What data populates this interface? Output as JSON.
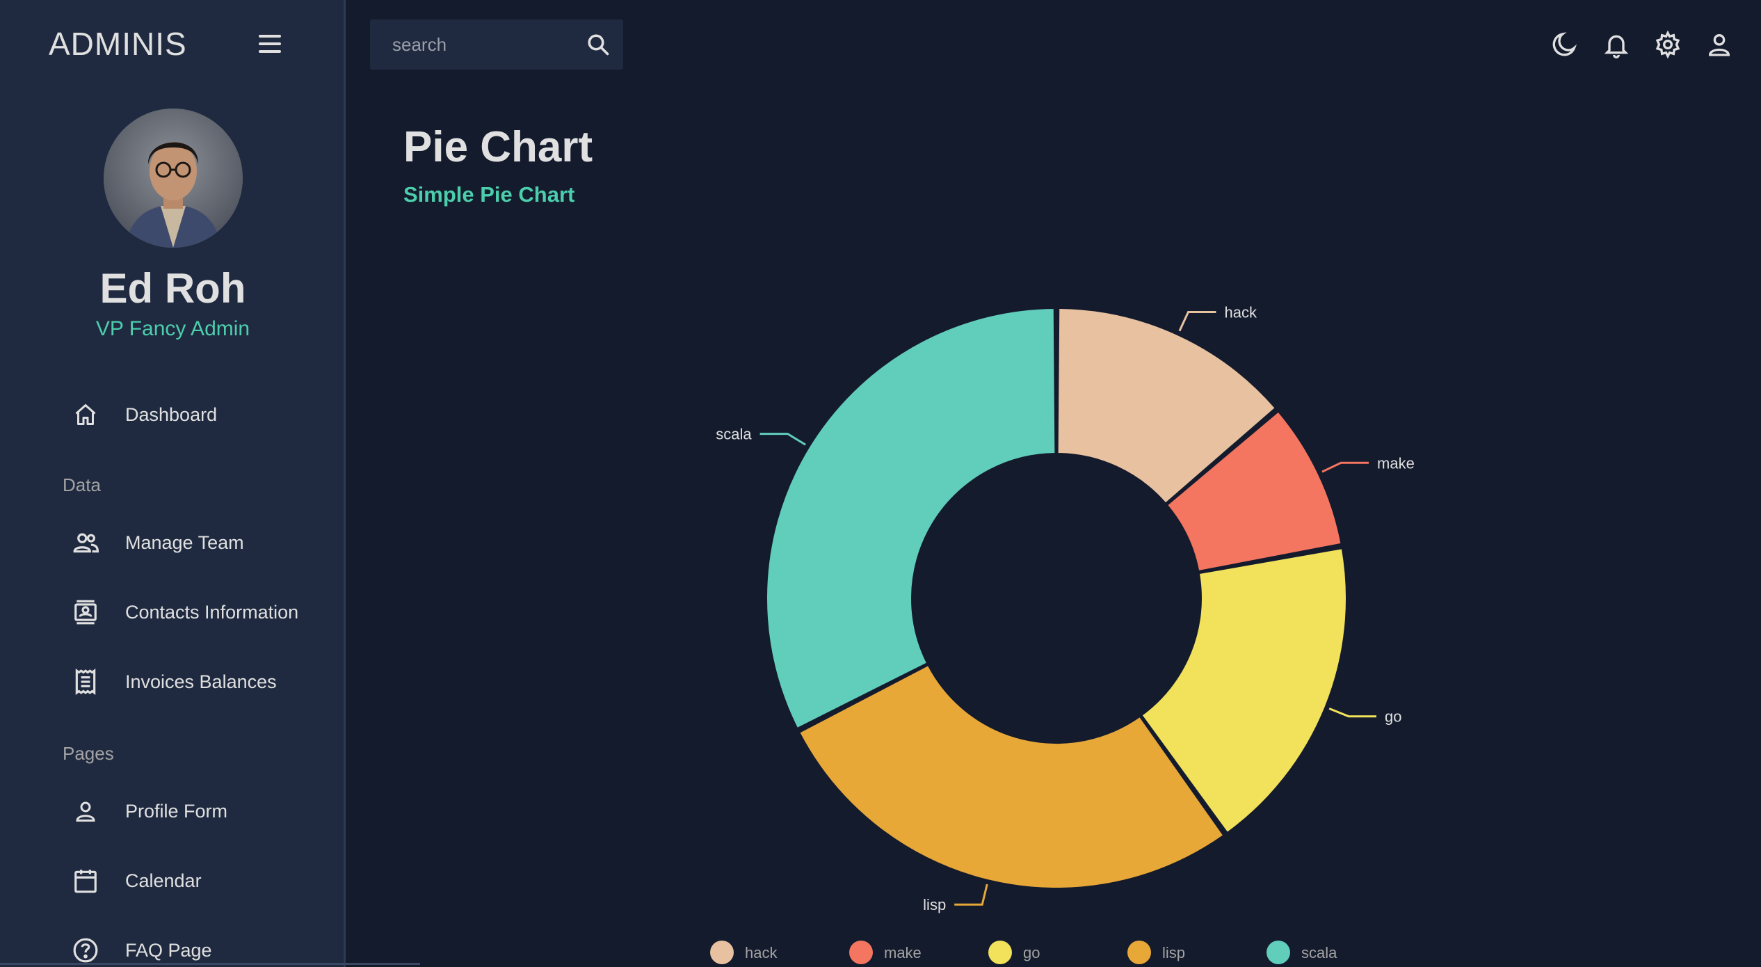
{
  "app": {
    "brand": "ADMINIS",
    "search": {
      "placeholder": "search"
    }
  },
  "profile": {
    "name": "Ed Roh",
    "role": "VP Fancy Admin"
  },
  "sidebar": {
    "items": [
      {
        "label": "Dashboard",
        "icon": "home-icon"
      },
      {
        "section": "Data"
      },
      {
        "label": "Manage Team",
        "icon": "people-icon"
      },
      {
        "label": "Contacts Information",
        "icon": "contacts-icon"
      },
      {
        "label": "Invoices Balances",
        "icon": "receipt-icon"
      },
      {
        "section": "Pages"
      },
      {
        "label": "Profile Form",
        "icon": "person-icon"
      },
      {
        "label": "Calendar",
        "icon": "calendar-icon"
      },
      {
        "label": "FAQ Page",
        "icon": "help-icon"
      }
    ]
  },
  "topbar": {
    "icons": [
      "dark-mode-icon",
      "notifications-icon",
      "settings-icon",
      "account-icon"
    ]
  },
  "header": {
    "title": "Pie Chart",
    "subtitle": "Simple Pie Chart"
  },
  "colors": {
    "background": "#141b2d",
    "sidebar": "#1f2a40",
    "accent": "#4cceac"
  },
  "chart_data": {
    "type": "pie",
    "donut": true,
    "categories": [
      "hack",
      "make",
      "go",
      "lisp",
      "scala"
    ],
    "values": [
      136,
      83,
      178,
      271,
      322
    ],
    "colors": [
      "#e8c1a0",
      "#f47560",
      "#f1e15b",
      "#e8a838",
      "#61cdbb"
    ],
    "legend_position": "bottom"
  }
}
